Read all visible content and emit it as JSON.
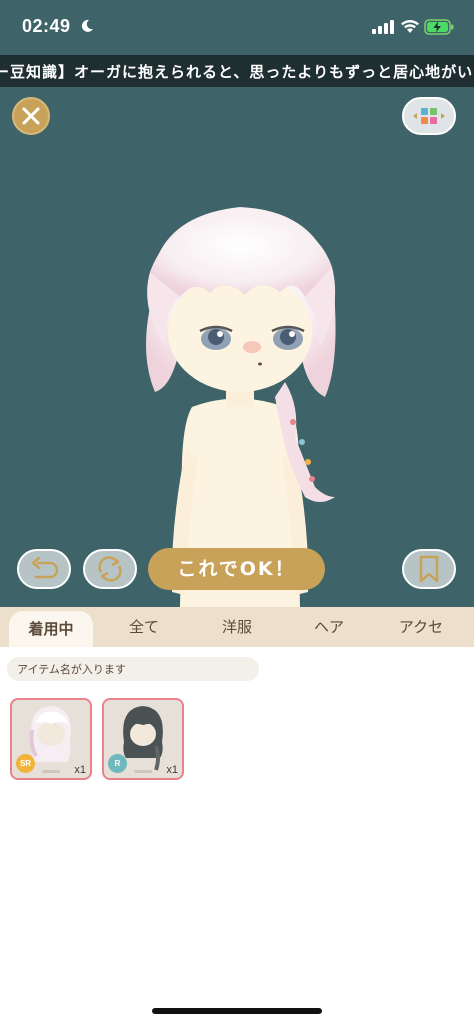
{
  "status_bar": {
    "time": "02:49",
    "icons": [
      "moon-icon",
      "signal-icon",
      "wifi-icon",
      "battery-charging-icon"
    ]
  },
  "ticker": {
    "text": "ー豆知識】オーガに抱えられると、思ったよりもずっと居心地がいいら"
  },
  "toolbar": {
    "close_icon": "close-icon",
    "palette_icon": "color-palette-icon",
    "undo_icon": "undo-icon",
    "shuffle_icon": "shuffle-icon",
    "ok_label": "これでOK！",
    "bookmark_icon": "bookmark-icon"
  },
  "tabs": [
    {
      "label": "着用中",
      "active": true
    },
    {
      "label": "全て",
      "active": false
    },
    {
      "label": "洋服",
      "active": false
    },
    {
      "label": "ヘア",
      "active": false
    },
    {
      "label": "アクセ",
      "active": false
    }
  ],
  "search": {
    "placeholder": "アイテム名が入ります"
  },
  "items": [
    {
      "rarity": "SR",
      "rarity_color": "#f2b33d",
      "quantity": "x1",
      "hair": "white-pink-wavy"
    },
    {
      "rarity": "R",
      "rarity_color": "#6fb8bd",
      "quantity": "x1",
      "hair": "dark-gray-braid"
    }
  ],
  "colors": {
    "stage_bg": "#3e6368",
    "accent_gold": "#c9a25a",
    "tab_bar": "#ecdfcb",
    "card_border": "#e8838e"
  }
}
